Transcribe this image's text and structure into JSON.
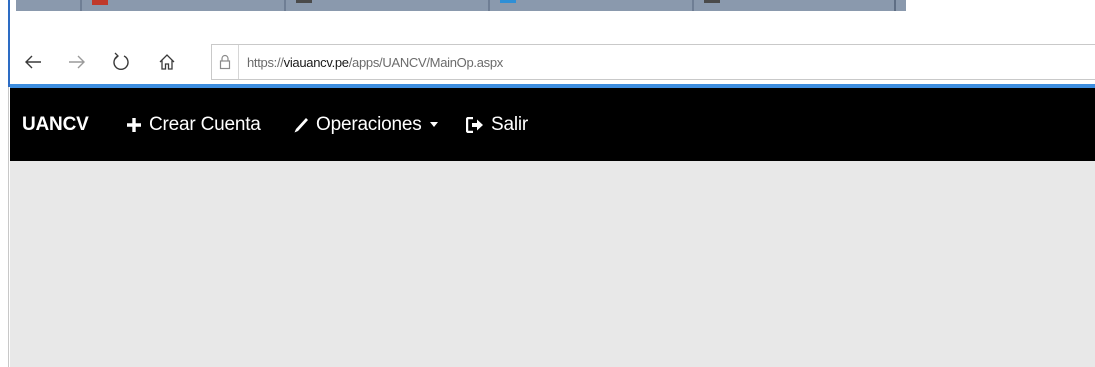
{
  "browser": {
    "url_prefix": "https://",
    "url_domain": "viauancv.pe",
    "url_path": "/apps/UANCV/MainOp.aspx",
    "icons": [
      "back-arrow-icon",
      "forward-arrow-icon",
      "refresh-icon",
      "home-icon",
      "lock-icon"
    ],
    "colors": {
      "tab_strip": "#8a99ad",
      "accent_line": "#3d8ee0"
    }
  },
  "navbar": {
    "brand": "UANCV",
    "items": [
      {
        "label": "Crear Cuenta",
        "icon": "plus-icon"
      },
      {
        "label": "Operaciones",
        "icon": "pencil-icon",
        "dropdown": true
      },
      {
        "label": "Salir",
        "icon": "sign-out-icon"
      }
    ],
    "background": "#000000"
  },
  "content": {
    "background": "#e8e8e8"
  }
}
